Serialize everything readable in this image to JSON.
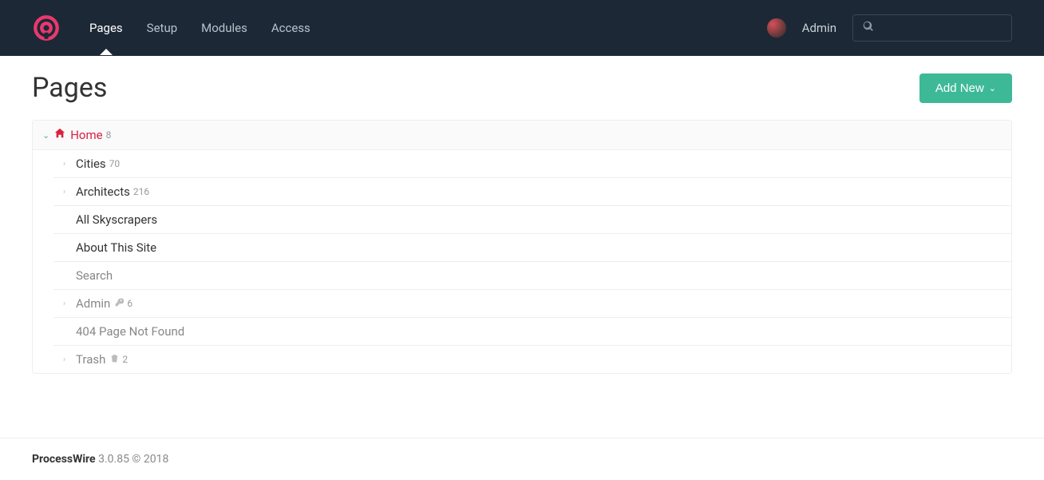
{
  "nav": {
    "items": [
      {
        "label": "Pages",
        "active": true
      },
      {
        "label": "Setup",
        "active": false
      },
      {
        "label": "Modules",
        "active": false
      },
      {
        "label": "Access",
        "active": false
      }
    ]
  },
  "user": {
    "name": "Admin"
  },
  "search": {
    "placeholder": ""
  },
  "page": {
    "title": "Pages",
    "add_new_label": "Add New"
  },
  "tree": {
    "root": {
      "label": "Home",
      "count": "8"
    },
    "children": [
      {
        "label": "Cities",
        "count": "70",
        "expandable": true,
        "muted": false,
        "icon": null
      },
      {
        "label": "Architects",
        "count": "216",
        "expandable": true,
        "muted": false,
        "icon": null
      },
      {
        "label": "All Skyscrapers",
        "count": "",
        "expandable": false,
        "muted": false,
        "icon": null
      },
      {
        "label": "About This Site",
        "count": "",
        "expandable": false,
        "muted": false,
        "icon": null
      },
      {
        "label": "Search",
        "count": "",
        "expandable": false,
        "muted": true,
        "icon": null
      },
      {
        "label": "Admin",
        "count": "6",
        "expandable": true,
        "muted": true,
        "icon": "key"
      },
      {
        "label": "404 Page Not Found",
        "count": "",
        "expandable": false,
        "muted": true,
        "icon": null
      },
      {
        "label": "Trash",
        "count": "2",
        "expandable": true,
        "muted": true,
        "icon": "trash"
      }
    ]
  },
  "footer": {
    "product": "ProcessWire",
    "version": "3.0.85 © 2018"
  }
}
